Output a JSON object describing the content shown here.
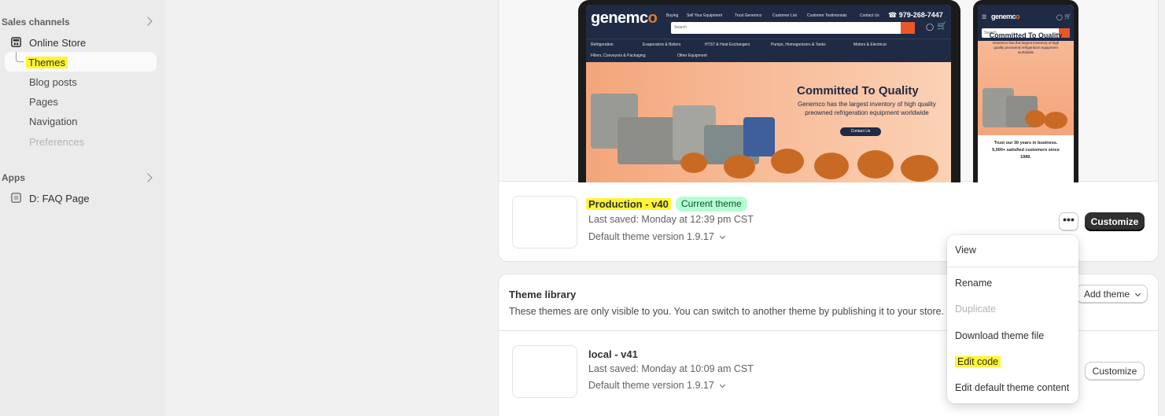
{
  "sidebar": {
    "sales_channels": "Sales channels",
    "online_store": "Online Store",
    "items": [
      {
        "label": "Themes"
      },
      {
        "label": "Blog posts"
      },
      {
        "label": "Pages"
      },
      {
        "label": "Navigation"
      },
      {
        "label": "Preferences"
      }
    ],
    "apps": "Apps",
    "app_items": [
      {
        "label": "D: FAQ Page"
      }
    ]
  },
  "preview": {
    "desktop": {
      "logo_main": "genemc",
      "logo_o": "o",
      "topnav": [
        "Buying",
        "Sell Your Equipment",
        "Trust Genemco",
        "Customer List",
        "Customer Testimonials",
        "Contact Us"
      ],
      "phone": "979-268-7447",
      "search_placeholder": "Search",
      "menu": [
        "Refrigeration",
        "Evaporators & Boilers",
        "HTST & Heat Exchangers",
        "Pumps, Homogenizers & Tanks",
        "Motors & Electrical",
        "Fillers, Conveyors & Packaging",
        "Other Equipment"
      ],
      "hero_title": "Committed To Quality",
      "hero_sub": "Genemco has the largest inventory of high quality preowned refrigeration equipment worldwide",
      "hero_button": "Contact Us"
    },
    "mobile": {
      "logo_main": "genemc",
      "logo_o": "o",
      "search_placeholder": "Search",
      "hero_title": "Committed To Quality",
      "hero_sub": "Genemco has the largest inventory of high quality preowned refrigeration equipment worldwide",
      "trust_line1": "Trust our 30 years in business.",
      "trust_line2": "5,000+ satisfied customers since",
      "trust_line3": "1989."
    }
  },
  "current_theme": {
    "name": "Production - v40",
    "badge": "Current theme",
    "last_saved": "Last saved: Monday at 12:39 pm CST",
    "version": "Default theme version 1.9.17",
    "more_label": "•••",
    "customize": "Customize"
  },
  "menu": {
    "items": [
      {
        "label": "View",
        "disabled": false
      },
      {
        "label": "Rename",
        "disabled": false
      },
      {
        "label": "Duplicate",
        "disabled": true
      },
      {
        "label": "Download theme file",
        "disabled": false
      },
      {
        "label": "Edit code",
        "disabled": false
      },
      {
        "label": "Edit default theme content",
        "disabled": false
      }
    ]
  },
  "library": {
    "title": "Theme library",
    "description": "These themes are only visible to you. You can switch to another theme by publishing it to your store.",
    "add_theme": "Add theme",
    "themes": [
      {
        "name": "local - v41",
        "last_saved": "Last saved: Monday at 10:09 am CST",
        "version": "Default theme version 1.9.17",
        "customize": "Customize"
      }
    ]
  },
  "colors": {
    "highlight": "#fff533",
    "badge_bg": "#b4fed2",
    "badge_text": "#0c5132",
    "primary_btn": "#303030",
    "brand_navy": "#1f2a44",
    "brand_orange": "#e07a2c"
  }
}
